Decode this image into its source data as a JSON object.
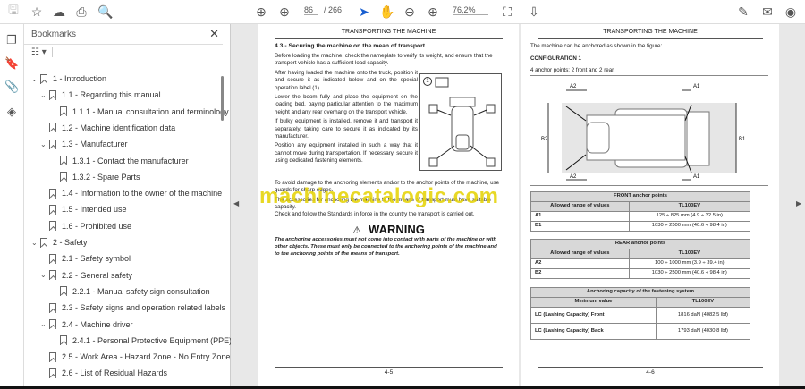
{
  "toolbar": {
    "page_current": "86",
    "page_total": "/ 266",
    "zoom": "76,2%"
  },
  "bookmarks": {
    "title": "Bookmarks",
    "items": [
      {
        "label": "1  -  Introduction",
        "level": 0,
        "chev": "down"
      },
      {
        "label": "1.1 - Regarding this manual",
        "level": 1,
        "chev": "down"
      },
      {
        "label": "1.1.1 - Manual consultation and terminology",
        "level": 2
      },
      {
        "label": "1.2 - Machine identification data",
        "level": 1
      },
      {
        "label": "1.3 - Manufacturer",
        "level": 1,
        "chev": "down"
      },
      {
        "label": "1.3.1 - Contact the manufacturer",
        "level": 2
      },
      {
        "label": "1.3.2 - Spare Parts",
        "level": 2
      },
      {
        "label": "1.4 - Information to the owner of the machine",
        "level": 1
      },
      {
        "label": "1.5 - Intended use",
        "level": 1
      },
      {
        "label": "1.6 - Prohibited use",
        "level": 1
      },
      {
        "label": "2  -  Safety",
        "level": 0,
        "chev": "down"
      },
      {
        "label": "2.1 - Safety symbol",
        "level": 1
      },
      {
        "label": "2.2 - General safety",
        "level": 1,
        "chev": "down"
      },
      {
        "label": "2.2.1 - Manual safety sign consultation",
        "level": 2
      },
      {
        "label": "2.3 - Safety signs and operation related labels",
        "level": 1
      },
      {
        "label": "2.4 - Machine driver",
        "level": 1,
        "chev": "down"
      },
      {
        "label": "2.4.1 - Personal Protective Equipment (PPE)",
        "level": 2
      },
      {
        "label": "2.5 - Work Area - Hazard Zone - No Entry Zone",
        "level": 1
      },
      {
        "label": "2.6 - List of Residual Hazards",
        "level": 1
      }
    ]
  },
  "left_page": {
    "header": "TRANSPORTING THE MACHINE",
    "heading": "4.3 - Securing the machine on the mean of transport",
    "p1": "Before loading the machine, check the nameplate to verify its weight, and ensure that the transport vehicle has a sufficient load capacity.",
    "p2": "After having loaded the machine onto the truck, position it and secure it as indicated below and on the special operation label (1).",
    "p3": "Lower the boom fully and place the equipment on the loading bed, paying particular attention to the maximum height and any rear overhang on the transport vehicle.",
    "p4": "If bulky equipment is installed, remove it and transport it separately, taking care to secure it as indicated by its manufacturer.",
    "p5": "Position any equipment installed in such a way that it cannot move during transportation. If necessary, secure it using dedicated fastening elements.",
    "fig_label": "1",
    "p6": "To avoid damage to the anchoring elements and/or to the anchor points of the machine, use guards for sharp edges.",
    "p7": "The accessories for anchoring the machine to the means of transport must have suitable capacity.",
    "p8": "Check and follow the Standards in force in the country the transport is carried out.",
    "warning_title": "WARNING",
    "warning_text": "The anchoring accessories must not come into contact with parts of the machine or with other objects. These must only be connected to the anchoring points of the machine and to the anchoring points of the means of transport.",
    "footer": "4-5"
  },
  "right_page": {
    "header": "TRANSPORTING THE MACHINE",
    "intro": "The machine can be anchored as shown in the figure:",
    "config": "CONFIGURATION 1",
    "points": "4 anchor points: 2 front and 2 rear.",
    "dims": {
      "a1": "A1",
      "a2": "A2",
      "b1": "B1",
      "b2": "B2"
    },
    "front_table": {
      "title": "FRONT anchor points",
      "col1": "Allowed range of values",
      "col2": "TL100EV",
      "rows": [
        [
          "A1",
          "125 ÷ 825 mm (4.9 ÷ 32.5 in)"
        ],
        [
          "B1",
          "1030 ÷ 2500 mm (40.6 ÷ 98.4 in)"
        ]
      ]
    },
    "rear_table": {
      "title": "REAR anchor points",
      "col1": "Allowed range of values",
      "col2": "TL100EV",
      "rows": [
        [
          "A2",
          "100 ÷ 1000 mm (3.9 ÷ 39.4 in)"
        ],
        [
          "B2",
          "1030 ÷ 2500 mm (40.6 ÷ 98.4 in)"
        ]
      ]
    },
    "cap_table": {
      "title": "Anchoring capacity of the fastening system",
      "col1": "Minimum value",
      "col2": "TL100EV",
      "rows": [
        [
          "LC (Lashing Capacity) Front",
          "1816 daN (4082.5 lbf)"
        ],
        [
          "LC (Lashing Capacity) Back",
          "1793 daN (4030.8 lbf)"
        ]
      ]
    },
    "footer": "4-6"
  },
  "watermark": "machinecatalogic.com"
}
